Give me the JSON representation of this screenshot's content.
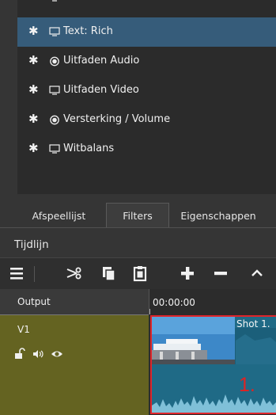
{
  "filters": {
    "items": [
      {
        "label": "",
        "icon": "monitor-icon",
        "partial": true
      },
      {
        "label": "Text: Rich",
        "icon": "monitor-icon",
        "selected": true
      },
      {
        "label": "Uitfaden Audio",
        "icon": "speaker-circle-icon"
      },
      {
        "label": "Uitfaden Video",
        "icon": "monitor-icon"
      },
      {
        "label": "Versterking / Volume",
        "icon": "speaker-circle-icon"
      },
      {
        "label": "Witbalans",
        "icon": "monitor-icon"
      }
    ],
    "star": "✱",
    "selected_color": "#365c7a"
  },
  "tabs": [
    {
      "label": "Afspeellijst"
    },
    {
      "label": "Filters",
      "active": true
    },
    {
      "label": "Eigenschappen"
    }
  ],
  "timeline": {
    "title": "Tijdlijn",
    "toolbar": [
      "menu-icon",
      "razor-icon",
      "copy-icon",
      "paste-icon",
      "add-icon",
      "remove-icon",
      "up-icon"
    ],
    "output_label": "Output",
    "ruler_time": "00:00:00",
    "track": {
      "name": "V1",
      "icons": [
        "lock-open-icon",
        "speaker-icon",
        "eye-icon"
      ],
      "color": "#646321"
    },
    "clip": {
      "label": "Shot 1.",
      "number": "1.",
      "color": "#1f6a86",
      "highlight": "#e0242a"
    }
  }
}
